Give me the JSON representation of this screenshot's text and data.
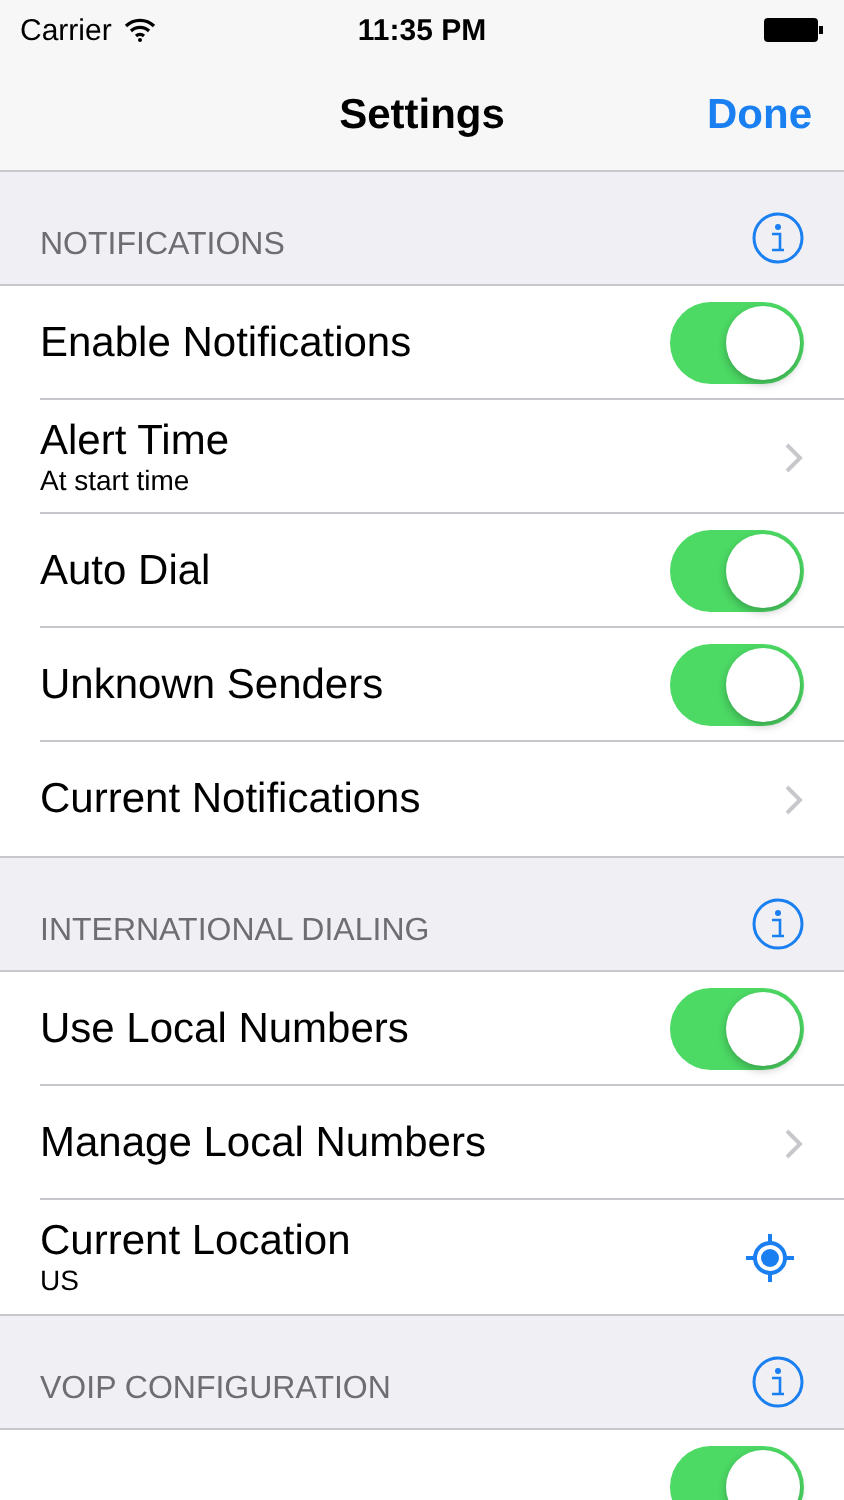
{
  "status_bar": {
    "carrier": "Carrier",
    "time": "11:35 PM"
  },
  "nav_bar": {
    "title": "Settings",
    "done_button": "Done"
  },
  "sections": [
    {
      "header": "NOTIFICATIONS",
      "rows": [
        {
          "kind": "toggle",
          "label": "Enable Notifications",
          "on": true
        },
        {
          "kind": "disclosure",
          "label": "Alert Time",
          "detail": "At start time"
        },
        {
          "kind": "toggle",
          "label": "Auto Dial",
          "on": true
        },
        {
          "kind": "toggle",
          "label": "Unknown Senders",
          "on": true
        },
        {
          "kind": "disclosure",
          "label": "Current Notifications"
        }
      ]
    },
    {
      "header": "INTERNATIONAL DIALING",
      "rows": [
        {
          "kind": "toggle",
          "label": "Use Local Numbers",
          "on": true
        },
        {
          "kind": "disclosure",
          "label": "Manage Local Numbers"
        },
        {
          "kind": "location",
          "label": "Current Location",
          "detail": "US"
        }
      ]
    },
    {
      "header": "VOIP CONFIGURATION",
      "rows": [
        {
          "kind": "toggle",
          "on": true
        }
      ]
    }
  ]
}
